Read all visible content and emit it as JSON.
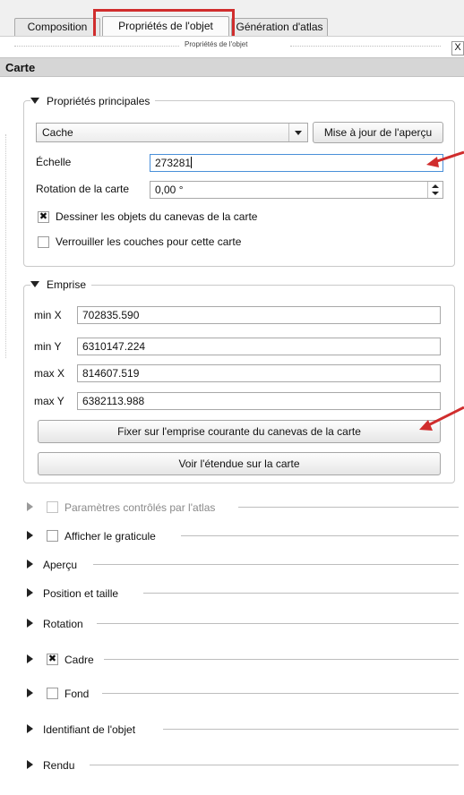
{
  "tabs": [
    {
      "label": "Composition"
    },
    {
      "label": "Propriétés de l'objet"
    },
    {
      "label": "Génération d'atlas"
    }
  ],
  "panel": {
    "subtitle": "Propriétés de l'objet",
    "close_label": "X",
    "section_title": "Carte"
  },
  "main_props": {
    "title": "Propriétés principales",
    "mode_value": "Cache",
    "update_preview_label": "Mise à jour de l'aperçu",
    "scale_label": "Échelle",
    "scale_value": "273281",
    "rotation_label": "Rotation de la carte",
    "rotation_value": "0,00 °",
    "draw_canvas_items_label": "Dessiner les objets du canevas de la carte",
    "draw_canvas_items_checked": true,
    "lock_layers_label": "Verrouiller les couches pour cette carte",
    "lock_layers_checked": false
  },
  "extent": {
    "title": "Emprise",
    "fields": [
      {
        "label": "min X",
        "value": "702835.590"
      },
      {
        "label": "min Y",
        "value": "6310147.224"
      },
      {
        "label": "max X",
        "value": "814607.519"
      },
      {
        "label": "max Y",
        "value": "6382113.988"
      }
    ],
    "set_extent_label": "Fixer sur l'emprise courante du canevas de la carte",
    "view_extent_label": "Voir l'étendue sur la carte"
  },
  "sections": [
    {
      "label": "Paramètres contrôlés par l'atlas",
      "has_checkbox": true,
      "checked": false,
      "disabled": true
    },
    {
      "label": "Afficher le graticule",
      "has_checkbox": true,
      "checked": false,
      "disabled": false
    },
    {
      "label": "Aperçu",
      "has_checkbox": false
    },
    {
      "label": "Position et taille",
      "has_checkbox": false
    },
    {
      "label": "Rotation",
      "has_checkbox": false
    },
    {
      "label": "Cadre",
      "has_checkbox": true,
      "checked": true,
      "disabled": false
    },
    {
      "label": "Fond",
      "has_checkbox": true,
      "checked": false,
      "disabled": false
    },
    {
      "label": "Identifiant de l'objet",
      "has_checkbox": false
    },
    {
      "label": "Rendu",
      "has_checkbox": false
    }
  ],
  "colors": {
    "highlight": "#d02d2d",
    "focus_border": "#4a90d9",
    "header_bg": "#d6d6d6"
  }
}
